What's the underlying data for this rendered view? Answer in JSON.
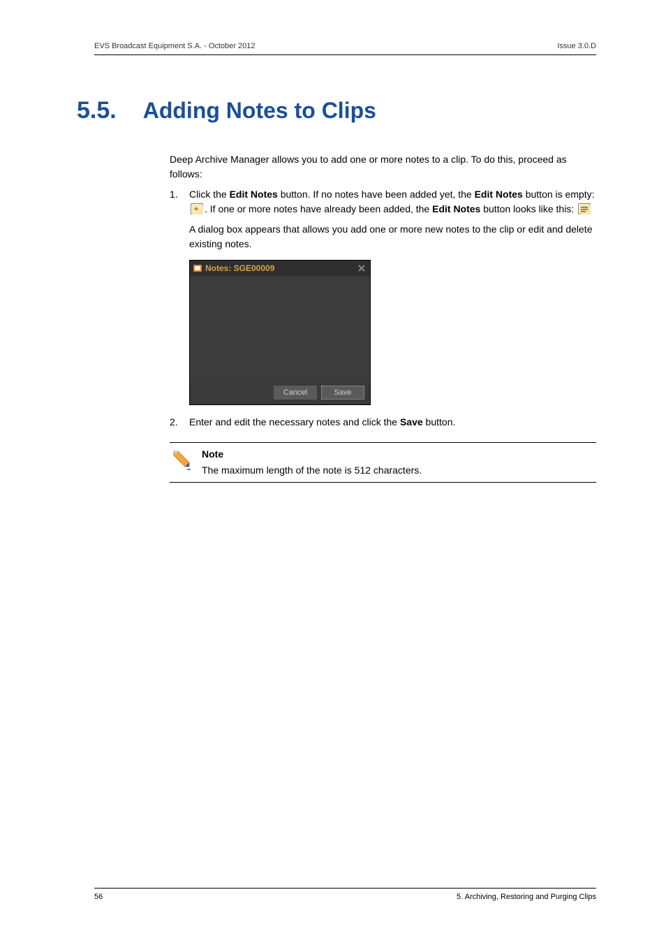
{
  "header": {
    "left": "EVS Broadcast Equipment S.A.  - October 2012",
    "right": "Issue 3.0.D"
  },
  "section": {
    "number": "5.5.",
    "title": "Adding Notes to Clips"
  },
  "intro": "Deep Archive Manager allows you to add one or more notes to a clip. To do this, proceed as follows:",
  "step1": {
    "pre": "Click the ",
    "bold1": "Edit Notes",
    "mid1": " button. If no notes have been added yet, the ",
    "bold2": "Edit Notes",
    "mid2": " button is empty: ",
    "mid3": ". If one or more notes have already been added, the ",
    "bold3": "Edit Notes",
    "mid4": " button looks like this: ",
    "after": "A dialog box appears that allows you add one or more new notes to the clip or edit and delete existing notes."
  },
  "dialog": {
    "title": "Notes: SGE00009",
    "cancel": "Cancel",
    "save": "Save"
  },
  "step2": {
    "pre": "Enter and edit the necessary notes and click the ",
    "bold1": "Save",
    "post": " button."
  },
  "note": {
    "title": "Note",
    "body": "The maximum length of the note is 512 characters."
  },
  "footer": {
    "left": "56",
    "right": "5. Archiving, Restoring and Purging Clips"
  }
}
